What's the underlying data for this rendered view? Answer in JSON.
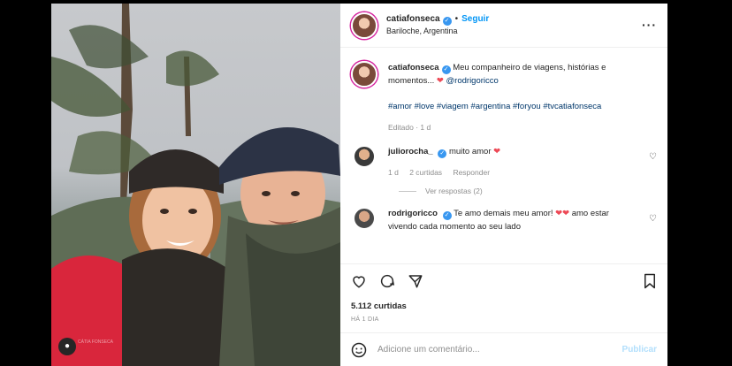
{
  "post": {
    "username": "catiafonseca",
    "follow_label": "Seguir",
    "location": "Bariloche, Argentina",
    "caption": {
      "username": "catiafonseca",
      "text": "Meu companheiro de viagens, histórias e momentos...",
      "mention": "@rodrigoricco",
      "hashtags": "#amor #love #viagem #argentina #foryou #tvcatiafonseca",
      "edited": "Editado · 1 d"
    },
    "likes": "5.112 curtidas",
    "time_ago": "HÁ 1 DIA",
    "watermark": "CÁTIA FONSECA"
  },
  "comments": [
    {
      "username": "juliorocha_",
      "text": "muito amor",
      "time": "1 d",
      "likes": "2 curtidas",
      "reply": "Responder",
      "view_replies": "Ver respostas (2)"
    },
    {
      "username": "rodrigoricco",
      "text": "Te amo demais meu amor!",
      "text2": "amo estar vivendo cada momento ao seu lado"
    }
  ],
  "add_comment": {
    "placeholder": "Adicione um comentário...",
    "publish_label": "Publicar"
  },
  "icons": [
    "heart-icon",
    "comment-icon",
    "share-icon",
    "bookmark-icon",
    "more-icon",
    "emoji-icon",
    "verified-icon"
  ],
  "colors": {
    "accent": "#0095f6",
    "heart": "#ed4956",
    "verified": "#3897f0",
    "publish_disabled": "#b2dffc"
  }
}
